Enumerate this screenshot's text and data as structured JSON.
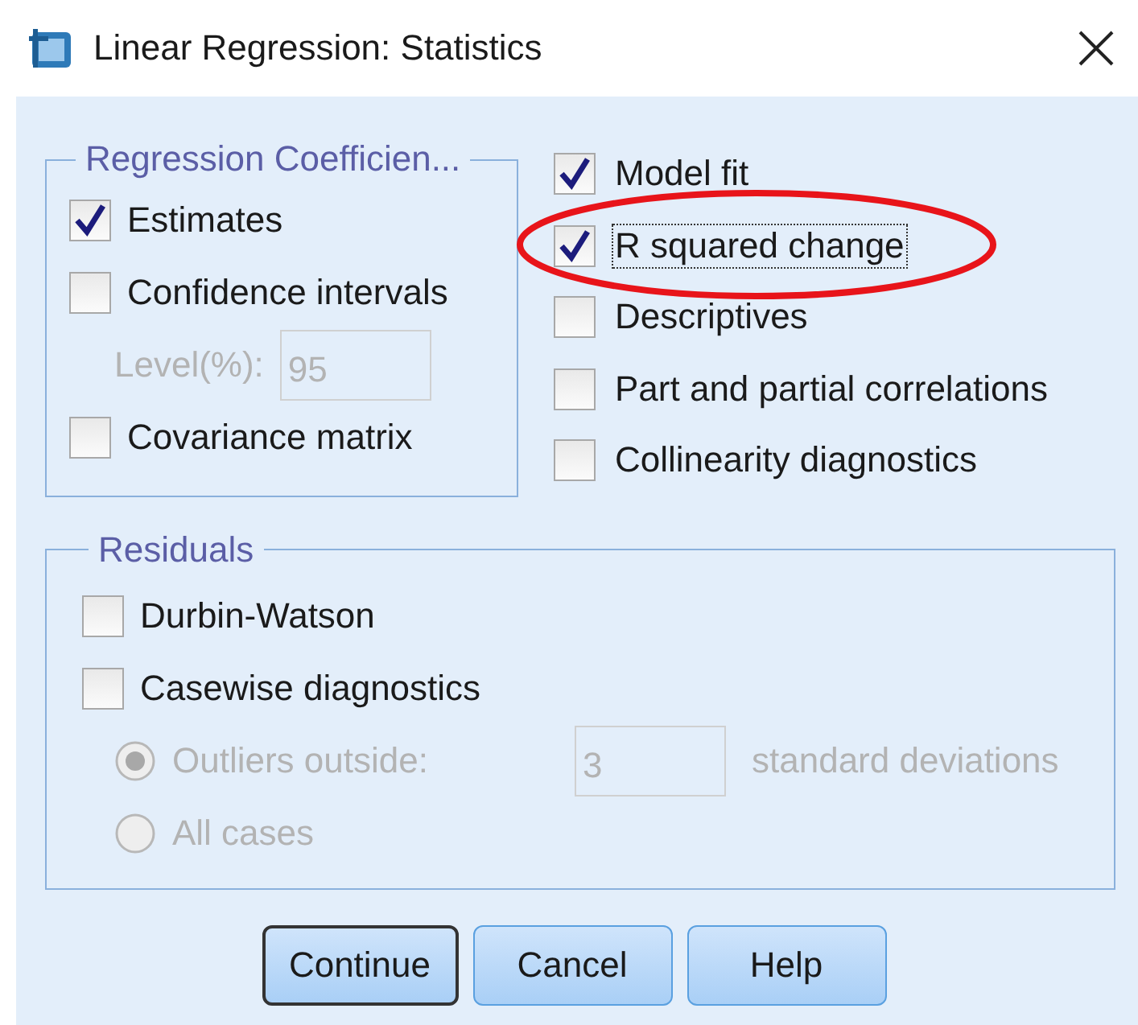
{
  "window": {
    "title": "Linear Regression: Statistics"
  },
  "coefficients": {
    "title": "Regression Coefficien...",
    "items": [
      {
        "kind": "checkbox",
        "label": "Estimates",
        "checked": true
      },
      {
        "kind": "checkbox",
        "label": "Confidence intervals",
        "checked": false
      },
      {
        "kind": "field",
        "label": "Level(%):",
        "value": "95",
        "disabled": true
      },
      {
        "kind": "checkbox",
        "label": "Covariance matrix",
        "checked": false
      }
    ]
  },
  "options": [
    {
      "label": "Model fit",
      "checked": true,
      "circled": false,
      "focused": false
    },
    {
      "label": "R squared change",
      "checked": true,
      "circled": true,
      "focused": true
    },
    {
      "label": "Descriptives",
      "checked": false,
      "circled": false,
      "focused": false
    },
    {
      "label": "Part and partial correlations",
      "checked": false,
      "circled": false,
      "focused": false
    },
    {
      "label": "Collinearity diagnostics",
      "checked": false,
      "circled": false,
      "focused": false
    }
  ],
  "residuals": {
    "title": "Residuals",
    "items": [
      {
        "kind": "checkbox",
        "label": "Durbin-Watson",
        "checked": false
      },
      {
        "kind": "checkbox",
        "label": "Casewise diagnostics",
        "checked": false
      },
      {
        "kind": "radio",
        "label": "Outliers outside:",
        "selected": true,
        "disabled": true,
        "value": "3",
        "suffix": "standard deviations"
      },
      {
        "kind": "radio",
        "label": "All cases",
        "selected": false,
        "disabled": true
      }
    ]
  },
  "buttons": [
    {
      "label": "Continue",
      "default": true
    },
    {
      "label": "Cancel",
      "default": false
    },
    {
      "label": "Help",
      "default": false
    }
  ]
}
